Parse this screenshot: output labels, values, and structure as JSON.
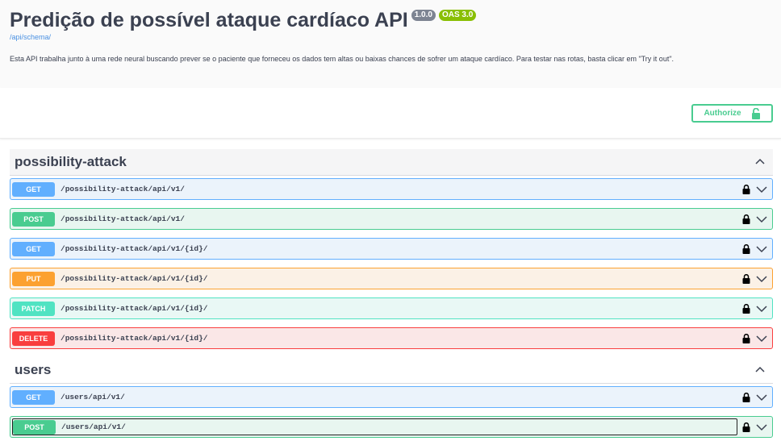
{
  "info": {
    "title": "Predição de possível ataque cardíaco API",
    "version_badge": "1.0.0",
    "oas_badge": "OAS 3.0",
    "schema_link": "/api/schema/",
    "description": "Esta API trabalha junto à uma rede neural buscando prever se o paciente que forneceu os dados tem altas ou baixas chances de sofrer um ataque cardíaco. Para testar nas rotas, basta clicar em \"Try it out\"."
  },
  "authorize": {
    "label": "Authorize"
  },
  "tags": [
    {
      "name": "possibility-attack",
      "operations": [
        {
          "method": "GET",
          "path": "/possibility-attack/api/v1/"
        },
        {
          "method": "POST",
          "path": "/possibility-attack/api/v1/"
        },
        {
          "method": "GET",
          "path": "/possibility-attack/api/v1/{id}/"
        },
        {
          "method": "PUT",
          "path": "/possibility-attack/api/v1/{id}/"
        },
        {
          "method": "PATCH",
          "path": "/possibility-attack/api/v1/{id}/"
        },
        {
          "method": "DELETE",
          "path": "/possibility-attack/api/v1/{id}/"
        }
      ]
    },
    {
      "name": "users",
      "operations": [
        {
          "method": "GET",
          "path": "/users/api/v1/"
        },
        {
          "method": "POST",
          "path": "/users/api/v1/"
        }
      ]
    }
  ],
  "colors": {
    "get": "#61affe",
    "post": "#49cc90",
    "put": "#fca130",
    "patch": "#50e3c2",
    "delete": "#f93e3e"
  }
}
